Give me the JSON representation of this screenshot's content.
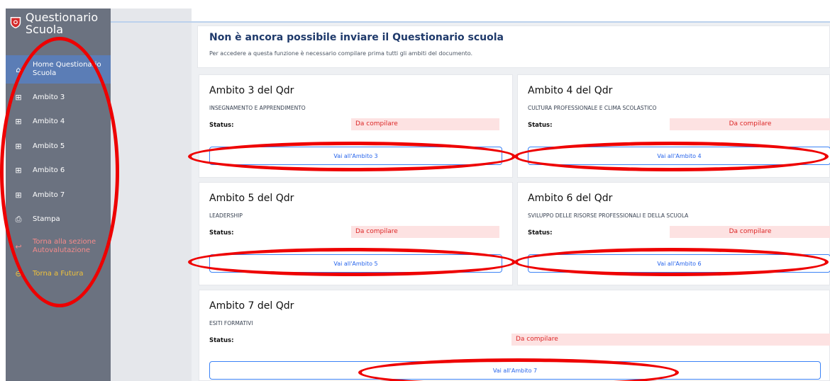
{
  "sidebar": {
    "title": "Questionario Scuola",
    "items": [
      {
        "label": "Home Questionario Scuola",
        "icon": "home-icon"
      },
      {
        "label": "Ambito 3",
        "icon": "grid-icon"
      },
      {
        "label": "Ambito 4",
        "icon": "grid-icon"
      },
      {
        "label": "Ambito 5",
        "icon": "grid-icon"
      },
      {
        "label": "Ambito 6",
        "icon": "grid-icon"
      },
      {
        "label": "Ambito 7",
        "icon": "grid-icon"
      },
      {
        "label": "Stampa",
        "icon": "print-icon"
      },
      {
        "label": "Torna alla sezione Autovalutazione",
        "icon": "back-icon"
      },
      {
        "label": "Torna a Futura",
        "icon": "arrow-left-circle-icon"
      }
    ]
  },
  "header": {
    "title": "Non è ancora possibile inviare il Questionario scuola",
    "subtitle": "Per accedere a questa funzione è necessario compilare prima tutti gli ambiti del documento."
  },
  "status_label": "Status:",
  "status_value": "Da compilare",
  "cards": [
    {
      "title": "Ambito 3  del Qdr",
      "subtitle": "INSEGNAMENTO E APPRENDIMENTO",
      "button": "Vai all'Ambito 3"
    },
    {
      "title": "Ambito 4  del Qdr",
      "subtitle": "CULTURA PROFESSIONALE E CLIMA SCOLASTICO",
      "button": "Vai all'Ambito 4"
    },
    {
      "title": "Ambito 5  del Qdr",
      "subtitle": "LEADERSHIP",
      "button": "Vai all'Ambito 5"
    },
    {
      "title": "Ambito 6  del Qdr",
      "subtitle": "SVILUPPO DELLE RISORSE PROFESSIONALI E DELLA SCUOLA",
      "button": "Vai all'Ambito 6"
    },
    {
      "title": "Ambito 7  del Qdr",
      "subtitle": "ESITI FORMATIVI",
      "button": "Vai all'Ambito 7"
    }
  ],
  "colors": {
    "sidebar": "#6b7280",
    "active": "#5b7db6",
    "title": "#1f3a6b",
    "status_bg": "#fde2e2",
    "status_text": "#dc2626",
    "button_border": "#3b82f6",
    "annotation": "#e00000"
  }
}
